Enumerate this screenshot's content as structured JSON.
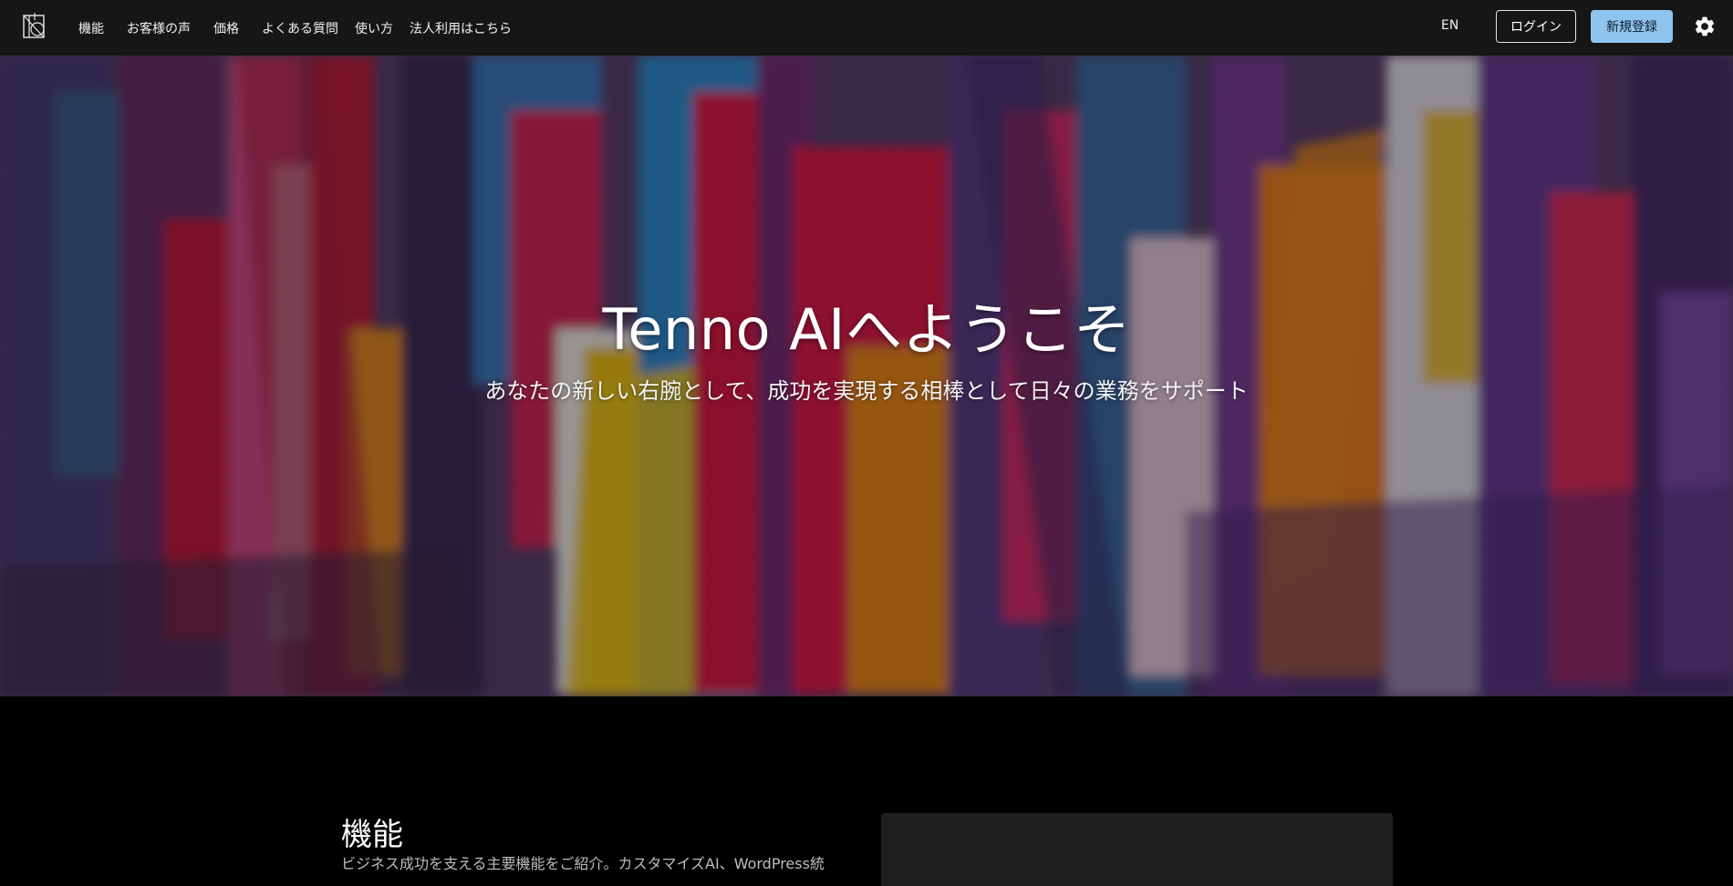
{
  "brand": {
    "logo_icon": "tenno-logo-icon"
  },
  "nav": {
    "items": [
      {
        "label": "機能"
      },
      {
        "label": "お客様の声"
      },
      {
        "label": "価格"
      },
      {
        "label": "よくある質問"
      },
      {
        "label": "使い方"
      },
      {
        "label": "法人利用はこちら"
      }
    ],
    "language": "EN",
    "login": "ログイン",
    "signup": "新規登録",
    "theme_icon": "gear-icon"
  },
  "hero": {
    "title": "Tenno AIへようこそ",
    "subtitle": "あなたの新しい右腕として、成功を実現する相棒として日々の業務をサポート"
  },
  "features": {
    "title": "機能",
    "description": "ビジネス成功を支える主要機能をご紹介。カスタマイズAI、WordPress統"
  },
  "colors": {
    "topbar": "#161616",
    "signup_button": "#8fc4ef",
    "page_background": "#000000",
    "card": "#1f1f1f"
  }
}
